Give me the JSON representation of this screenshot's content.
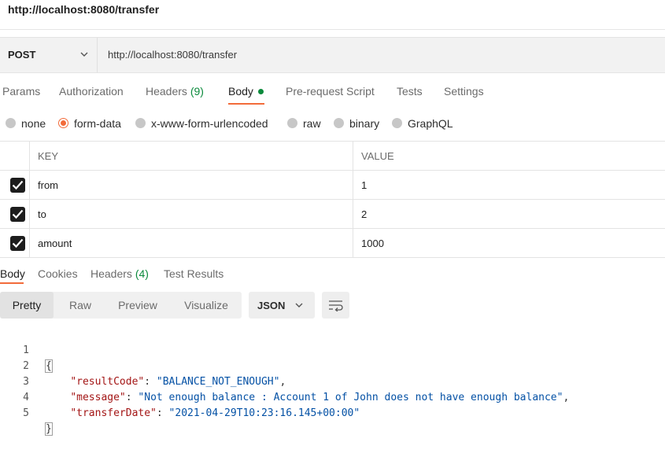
{
  "window": {
    "title": "http://localhost:8080/transfer"
  },
  "request": {
    "method": "POST",
    "url": "http://localhost:8080/transfer"
  },
  "request_tabs": [
    {
      "label": "Params"
    },
    {
      "label": "Authorization"
    },
    {
      "label": "Headers",
      "count": "(9)"
    },
    {
      "label": "Body",
      "active": true
    },
    {
      "label": "Pre-request Script"
    },
    {
      "label": "Tests"
    },
    {
      "label": "Settings"
    }
  ],
  "body_types": [
    {
      "label": "none"
    },
    {
      "label": "form-data",
      "selected": true
    },
    {
      "label": "x-www-form-urlencoded"
    },
    {
      "label": "raw"
    },
    {
      "label": "binary"
    },
    {
      "label": "GraphQL"
    }
  ],
  "params_table": {
    "headers": {
      "key": "KEY",
      "value": "VALUE"
    },
    "rows": [
      {
        "key": "from",
        "value": "1",
        "checked": true
      },
      {
        "key": "to",
        "value": "2",
        "checked": true
      },
      {
        "key": "amount",
        "value": "1000",
        "checked": true
      }
    ]
  },
  "response_tabs": [
    {
      "label": "Body",
      "active": true
    },
    {
      "label": "Cookies"
    },
    {
      "label": "Headers",
      "count": "(4)"
    },
    {
      "label": "Test Results"
    }
  ],
  "view_modes": [
    {
      "label": "Pretty",
      "active": true
    },
    {
      "label": "Raw"
    },
    {
      "label": "Preview"
    },
    {
      "label": "Visualize"
    }
  ],
  "format": {
    "label": "JSON"
  },
  "response_lines": [
    {
      "n": "1",
      "text": "{"
    },
    {
      "n": "2",
      "key": "\"resultCode\"",
      "value": "\"BALANCE_NOT_ENOUGH\"",
      "trail": ","
    },
    {
      "n": "3",
      "key": "\"message\"",
      "value": "\"Not enough balance : Account 1 of John does not have enough balance\"",
      "trail": ","
    },
    {
      "n": "4",
      "key": "\"transferDate\"",
      "value": "\"2021-04-29T10:23:16.145+00:00\"",
      "trail": ""
    },
    {
      "n": "5",
      "text": "}"
    }
  ],
  "colors": {
    "accent": "#f26b3a",
    "count_green": "#0b8a3c",
    "json_key": "#a31515",
    "json_string": "#0451a5"
  }
}
